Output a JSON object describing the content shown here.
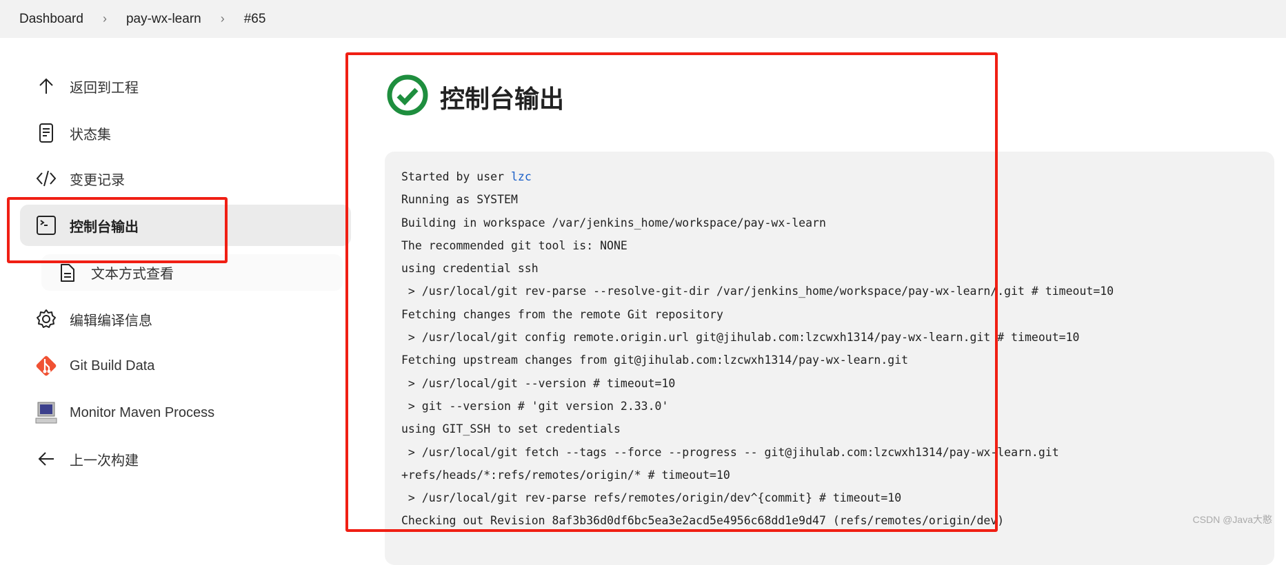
{
  "breadcrumb": [
    "Dashboard",
    "pay-wx-learn",
    "#65"
  ],
  "sidebar": {
    "items": [
      {
        "label": "返回到工程",
        "icon": "arrow-up-icon"
      },
      {
        "label": "状态集",
        "icon": "document-icon"
      },
      {
        "label": "变更记录",
        "icon": "code-icon"
      },
      {
        "label": "控制台输出",
        "icon": "terminal-icon",
        "active": true
      },
      {
        "label": "文本方式查看",
        "icon": "file-text-icon"
      },
      {
        "label": "编辑编译信息",
        "icon": "gear-icon"
      },
      {
        "label": "Git Build Data",
        "icon": "git-icon"
      },
      {
        "label": "Monitor Maven Process",
        "icon": "monitor-icon"
      },
      {
        "label": "上一次构建",
        "icon": "arrow-left-icon"
      }
    ]
  },
  "main": {
    "title": "控制台输出",
    "status_icon": "success-check-icon",
    "status_color": "#1e8e3e",
    "console": {
      "first_prefix": "Started by user ",
      "user": "lzc",
      "lines": [
        "Running as SYSTEM",
        "Building in workspace /var/jenkins_home/workspace/pay-wx-learn",
        "The recommended git tool is: NONE",
        "using credential ssh",
        " > /usr/local/git rev-parse --resolve-git-dir /var/jenkins_home/workspace/pay-wx-learn/.git # timeout=10",
        "Fetching changes from the remote Git repository",
        " > /usr/local/git config remote.origin.url git@jihulab.com:lzcwxh1314/pay-wx-learn.git # timeout=10",
        "Fetching upstream changes from git@jihulab.com:lzcwxh1314/pay-wx-learn.git",
        " > /usr/local/git --version # timeout=10",
        " > git --version # 'git version 2.33.0'",
        "using GIT_SSH to set credentials",
        " > /usr/local/git fetch --tags --force --progress -- git@jihulab.com:lzcwxh1314/pay-wx-learn.git",
        "+refs/heads/*:refs/remotes/origin/* # timeout=10",
        " > /usr/local/git rev-parse refs/remotes/origin/dev^{commit} # timeout=10",
        "Checking out Revision 8af3b36d0df6bc5ea3e2acd5e4956c68dd1e9d47 (refs/remotes/origin/dev)"
      ]
    }
  },
  "watermark": "CSDN @Java大憨",
  "highlight_color": "#f01f14"
}
